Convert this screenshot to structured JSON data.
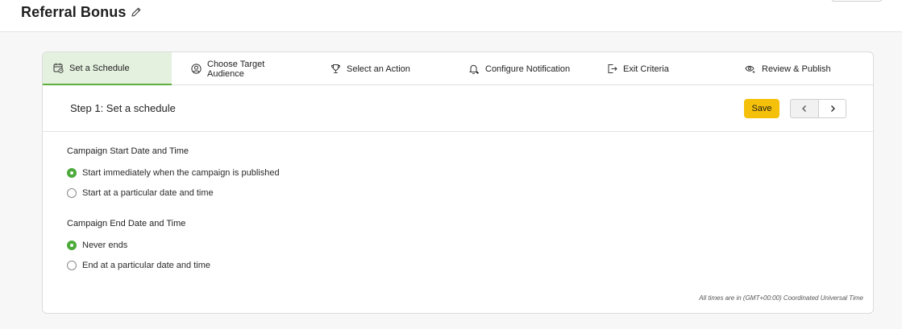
{
  "page": {
    "title": "Referral Bonus"
  },
  "stepper": {
    "steps": [
      {
        "label": "Set a Schedule",
        "icon": "calendar-clock-icon",
        "active": true
      },
      {
        "label": "Choose Target Audience",
        "icon": "user-circle-icon",
        "active": false
      },
      {
        "label": "Select an Action",
        "icon": "trophy-icon",
        "active": false
      },
      {
        "label": "Configure Notification",
        "icon": "bell-plus-icon",
        "active": false
      },
      {
        "label": "Exit Criteria",
        "icon": "exit-icon",
        "active": false
      },
      {
        "label": "Review & Publish",
        "icon": "eye-star-icon",
        "active": false
      }
    ]
  },
  "step": {
    "title": "Step 1: Set a schedule",
    "save_label": "Save"
  },
  "start": {
    "label": "Campaign Start Date and Time",
    "options": [
      {
        "label": "Start immediately when the campaign is published",
        "checked": true
      },
      {
        "label": "Start at a particular date and time",
        "checked": false
      }
    ]
  },
  "end": {
    "label": "Campaign End Date and Time",
    "options": [
      {
        "label": "Never ends",
        "checked": true
      },
      {
        "label": "End at a particular date and time",
        "checked": false
      }
    ]
  },
  "footnote": "All times are in (GMT+00:00) Coordinated Universal Time",
  "colors": {
    "accent": "#4caa3b",
    "active_tab_bg": "#e4f1df",
    "save_button": "#f5c009"
  }
}
